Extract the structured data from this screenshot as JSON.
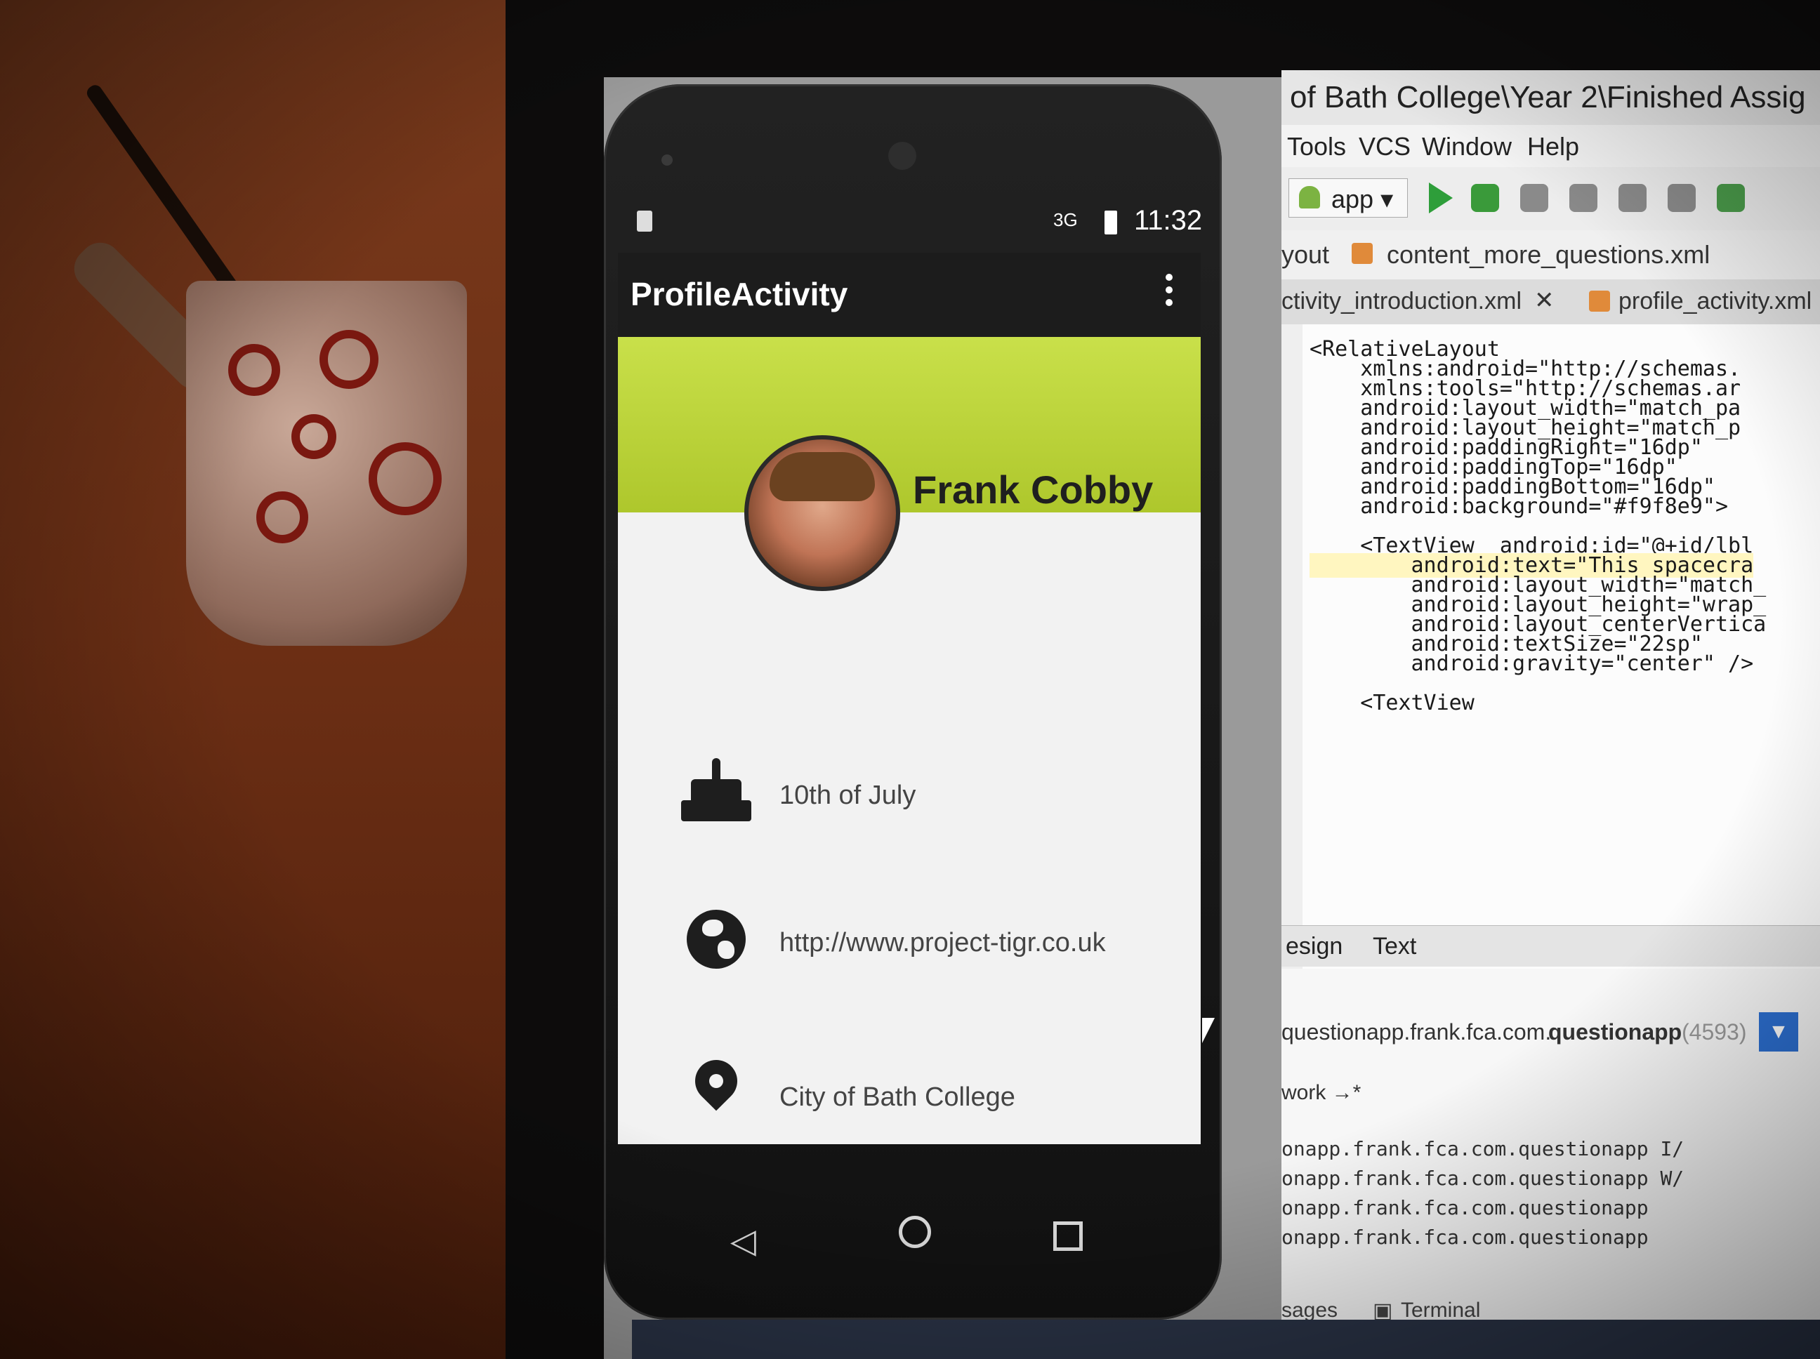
{
  "emulator": {
    "status_time": "11:32",
    "network": "3G",
    "app_title": "ProfileActivity",
    "profile_name": "Frank Cobby",
    "birthday": "10th of July",
    "website": "http://www.project-tigr.co.uk",
    "location": "City of Bath College",
    "colors": {
      "banner": "#b5cf34",
      "appbar": "#1c1c1c",
      "content_bg": "#f2f2f2"
    }
  },
  "studio": {
    "window_title": "of Bath College\\Year 2\\Finished Assig",
    "menu": [
      "Tools",
      "VCS",
      "Window",
      "Help"
    ],
    "run_config": "app",
    "breadcrumb": {
      "prefix": "yout",
      "file": "content_more_questions.xml"
    },
    "tabs": [
      "ctivity_introduction.xml",
      "profile_activity.xml"
    ],
    "code_lines": [
      "<RelativeLayout",
      "    xmlns:android=\"http://schemas.",
      "    xmlns:tools=\"http://schemas.ar",
      "    android:layout_width=\"match_pa",
      "    android:layout_height=\"match_p",
      "    android:paddingRight=\"16dp\"",
      "    android:paddingTop=\"16dp\"",
      "    android:paddingBottom=\"16dp\"",
      "    android:background=\"#f9f8e9\">",
      "",
      "    <TextView  android:id=\"@+id/lbl",
      "        android:text=\"This spacecra",
      "        android:layout_width=\"match_",
      "        android:layout_height=\"wrap_",
      "        android:layout_centerVertica",
      "        android:textSize=\"22sp\"",
      "        android:gravity=\"center\" />",
      "",
      "    <TextView"
    ],
    "bottom_tabs": [
      "esign",
      "Text"
    ],
    "process": {
      "name_prefix": "questionapp.frank.fca.com.",
      "name_bold": "questionapp",
      "pid": "(4593)"
    },
    "filter": "work →*",
    "log_lines": [
      "onapp.frank.fca.com.questionapp I/",
      "onapp.frank.fca.com.questionapp W/",
      "onapp.frank.fca.com.questionapp",
      "onapp.frank.fca.com.questionapp"
    ],
    "status_tabs": [
      "sages",
      "Terminal"
    ]
  }
}
